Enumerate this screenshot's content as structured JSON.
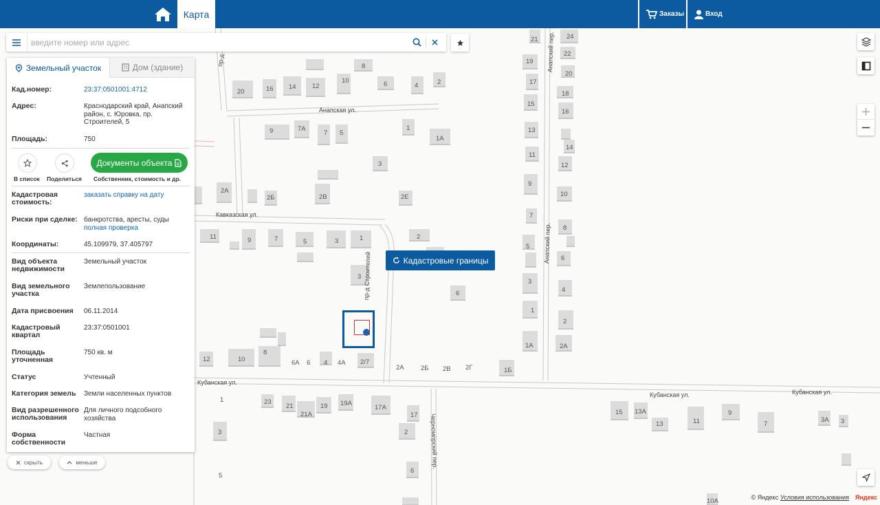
{
  "header": {
    "tab_map": "Карта",
    "orders": "Заказы",
    "login": "Вход",
    "brand_color": "#0c5aa0"
  },
  "search": {
    "placeholder": "введите номер или адрес"
  },
  "panel": {
    "tab_land": "Земельный участок",
    "tab_house": "Дом (здание)",
    "cad_number_label": "Кад.номер:",
    "cad_number": "23:37:0501001:4712",
    "address_label": "Адрес:",
    "address": "Краснодарский край, Анапский район, с. Юровка, пр. Строителей, 5",
    "area_label": "Площадь:",
    "area": "750",
    "to_list": "В список",
    "share": "Поделиться",
    "docs_button": "Документы объекта",
    "docs_caption": "Собственник, стоимость и др.",
    "cad_cost_label": "Кадастровая стоимость:",
    "cad_cost_link": "заказать справку на дату",
    "risks_label": "Риски при сделке:",
    "risks": "банкротства, аресты, суды",
    "risks_link": "полная проверка",
    "coords_label": "Координаты:",
    "coords": "45.109979, 37.405797",
    "obj_type_label": "Вид объекта недвижимости",
    "obj_type": "Земельный участок",
    "land_type_label": "Вид земельного участка",
    "land_type": "Землепользование",
    "date_label": "Дата присвоения",
    "date": "06.11.2014",
    "quarter_label": "Кадастровый квартал",
    "quarter": "23:37:0501001",
    "area_spec_label": "Площадь уточненная",
    "area_spec": "750 кв. м",
    "status_label": "Статус",
    "status": "Учтенный",
    "category_label": "Категория земель",
    "category": "Земли населенных пунктов",
    "usage_label": "Вид разрешенного использования",
    "usage": "Для личного подсобного хозяйства",
    "ownership_label": "Форма собственности",
    "ownership": "Частная",
    "accent_green": "#27a844"
  },
  "pills": {
    "hide": "скрыть",
    "less": "меньше"
  },
  "map": {
    "cad_bounds_button": "Кадастровые границы",
    "streets": {
      "anapskaya": "Анапская ул.",
      "kavkazskaya": "Кавказская ул.",
      "kubanskaya1": "Кубанская ул.",
      "kubanskaya2": "Кубанская ул.",
      "kubanskaya3": "Кубанская ул.",
      "stroiteley": "пр-д Строителей",
      "anapsky_per1": "Анапский пер.",
      "anapsky_per2": "Анапский пер.",
      "chernomorsky": "Черноморский пер.",
      "pr_d": "пр-д"
    },
    "house_numbers": [
      "24",
      "21",
      "22",
      "19",
      "20",
      "17",
      "18",
      "15",
      "16",
      "13",
      "14",
      "11",
      "12",
      "9",
      "10",
      "7",
      "8",
      "5",
      "6",
      "3",
      "4",
      "1",
      "2",
      "1А",
      "2А",
      "8",
      "6",
      "4",
      "2",
      "20",
      "16",
      "14",
      "12",
      "10",
      "9",
      "7А",
      "7",
      "5",
      "1",
      "1А",
      "3",
      "2А",
      "2Б",
      "2В",
      "2Е",
      "11",
      "9",
      "7",
      "5",
      "3",
      "1",
      "2",
      "3",
      "6",
      "8",
      "10",
      "12",
      "6А",
      "6",
      "4",
      "4А",
      "2/7",
      "2А",
      "2Б",
      "2В",
      "2Г",
      "1Б",
      "23",
      "21",
      "19",
      "19А",
      "17А",
      "17",
      "21А",
      "2",
      "1",
      "3",
      "5",
      "6",
      "15",
      "13А",
      "13",
      "11",
      "9",
      "7",
      "3А",
      "3",
      "10А"
    ],
    "footer_copy": "© Яндекс",
    "footer_terms": "Условия использования",
    "footer_logo": "Яндекс"
  }
}
